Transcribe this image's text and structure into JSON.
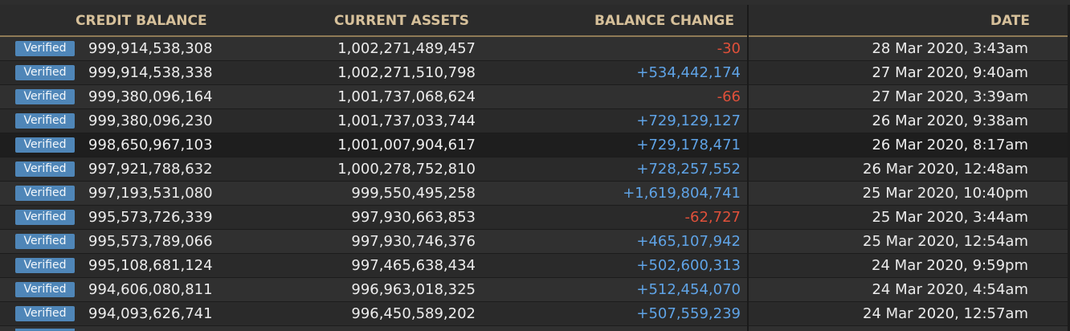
{
  "header": {
    "credit_balance": "CREDIT BALANCE",
    "current_assets": "CURRENT ASSETS",
    "balance_change": "BALANCE CHANGE",
    "date": "DATE"
  },
  "colors": {
    "header_text": "#d6c09a",
    "badge": "#4f86b8",
    "negative": "#e0503a",
    "positive": "#5fa3e6"
  },
  "rows": [
    {
      "badge": "Verified",
      "credit": "999,914,538,308",
      "assets": "1,002,271,489,457",
      "change": "-30",
      "sign": "neg",
      "date": "28 Mar 2020, 3:43am"
    },
    {
      "badge": "Verified",
      "credit": "999,914,538,338",
      "assets": "1,002,271,510,798",
      "change": "+534,442,174",
      "sign": "pos",
      "date": "27 Mar 2020, 9:40am"
    },
    {
      "badge": "Verified",
      "credit": "999,380,096,164",
      "assets": "1,001,737,068,624",
      "change": "-66",
      "sign": "neg",
      "date": "27 Mar 2020, 3:39am"
    },
    {
      "badge": "Verified",
      "credit": "999,380,096,230",
      "assets": "1,001,737,033,744",
      "change": "+729,129,127",
      "sign": "pos",
      "date": "26 Mar 2020, 9:38am"
    },
    {
      "badge": "Verified",
      "credit": "998,650,967,103",
      "assets": "1,001,007,904,617",
      "change": "+729,178,471",
      "sign": "pos",
      "date": "26 Mar 2020, 8:17am",
      "active": true
    },
    {
      "badge": "Verified",
      "credit": "997,921,788,632",
      "assets": "1,000,278,752,810",
      "change": "+728,257,552",
      "sign": "pos",
      "date": "26 Mar 2020, 12:48am"
    },
    {
      "badge": "Verified",
      "credit": "997,193,531,080",
      "assets": "999,550,495,258",
      "change": "+1,619,804,741",
      "sign": "pos",
      "date": "25 Mar 2020, 10:40pm"
    },
    {
      "badge": "Verified",
      "credit": "995,573,726,339",
      "assets": "997,930,663,853",
      "change": "-62,727",
      "sign": "neg",
      "date": "25 Mar 2020, 3:44am"
    },
    {
      "badge": "Verified",
      "credit": "995,573,789,066",
      "assets": "997,930,746,376",
      "change": "+465,107,942",
      "sign": "pos",
      "date": "25 Mar 2020, 12:54am"
    },
    {
      "badge": "Verified",
      "credit": "995,108,681,124",
      "assets": "997,465,638,434",
      "change": "+502,600,313",
      "sign": "pos",
      "date": "24 Mar 2020, 9:59pm"
    },
    {
      "badge": "Verified",
      "credit": "994,606,080,811",
      "assets": "996,963,018,325",
      "change": "+512,454,070",
      "sign": "pos",
      "date": "24 Mar 2020, 4:54am"
    },
    {
      "badge": "Verified",
      "credit": "994,093,626,741",
      "assets": "996,450,589,202",
      "change": "+507,559,239",
      "sign": "pos",
      "date": "24 Mar 2020, 12:57am"
    }
  ]
}
